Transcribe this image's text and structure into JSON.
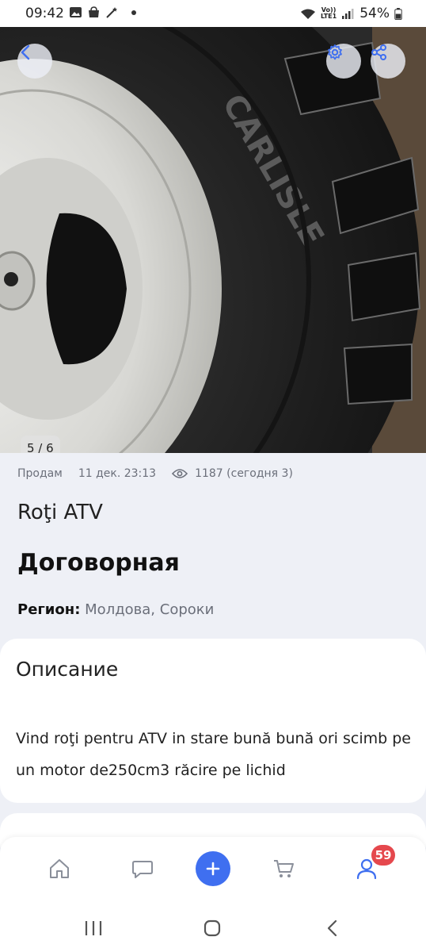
{
  "status_bar": {
    "time": "09:42",
    "battery": "54%",
    "network": "LTE1",
    "volte": "Vo))"
  },
  "photo": {
    "counter": "5 / 6"
  },
  "listing": {
    "type": "Продам",
    "date": "11 дек. 23:13",
    "views": "1187 (сегодня 3)",
    "title": "Roţi ATV",
    "price": "Договорная",
    "region_label": "Регион:",
    "region_value": "Молдова, Сороки"
  },
  "description": {
    "heading": "Описание",
    "text": "Vind roţi pentru ATV in stare bună bună ori scimb pe un motor de250cm3 răcire pe lichid"
  },
  "bottom_nav": {
    "badge_count": "59",
    "items": [
      "home-icon",
      "chat-icon",
      "plus-icon",
      "cart-icon",
      "profile-icon"
    ]
  },
  "colors": {
    "accent": "#3f6ff0",
    "badge": "#e5484d",
    "background": "#eef0f6"
  }
}
